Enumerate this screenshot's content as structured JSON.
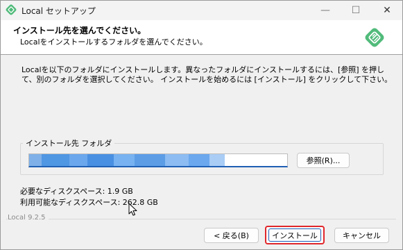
{
  "window": {
    "title": "Local セットアップ",
    "controls": {
      "minimize": "—",
      "maximize": "☐",
      "close": "✕"
    }
  },
  "header": {
    "title": "インストール先を選んでください。",
    "subtitle": "Localをインストールするフォルダを選んでください。"
  },
  "body": {
    "description": "Localを以下のフォルダにインストールします。異なったフォルダにインストールするには、[参照] を押して、別のフォルダを選択してください。 インストールを始めるには [インストール] をクリックして下さい。"
  },
  "folder_group": {
    "label": "インストール先 フォルダ",
    "path_value": "",
    "browse_label": "参照(R)..."
  },
  "disk": {
    "required": "必要なディスクスペース: 1.9 GB",
    "available": "利用可能なディスクスペース: 262.8 GB"
  },
  "footer": {
    "version": "Local 9.2.5",
    "back_label": "< 戻る(B)",
    "install_label": "インストール",
    "cancel_label": "キャンセル"
  },
  "colors": {
    "accent_blue": "#1f5fb4",
    "highlight_red": "#e0262b",
    "brand_green": "#51bb7b"
  }
}
